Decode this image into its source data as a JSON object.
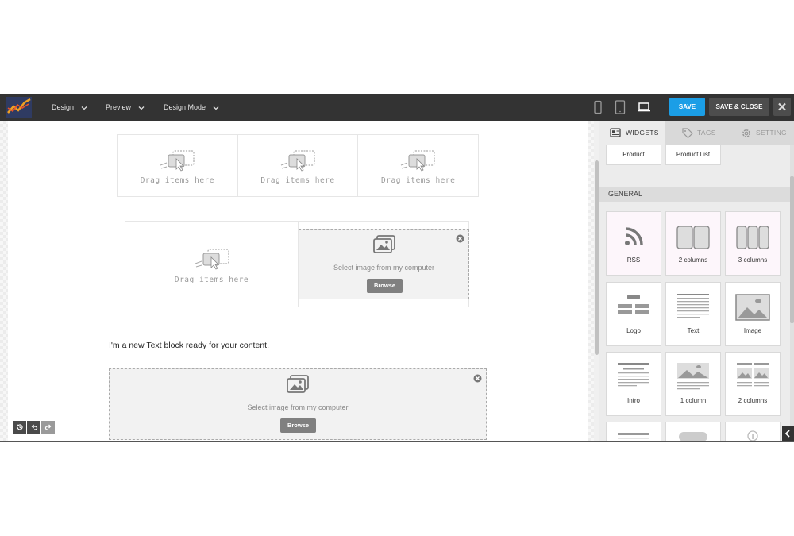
{
  "topbar": {
    "menus": [
      {
        "label": "Design"
      },
      {
        "label": "Preview"
      },
      {
        "label": "Design Mode"
      }
    ],
    "devices": [
      "mobile-icon",
      "tablet-icon",
      "laptop-icon"
    ],
    "save_label": "SAVE",
    "save_close_label": "SAVE & CLOSE",
    "colors": {
      "bar": "#333333",
      "save": "#1b9ee6",
      "save_close": "#4d4d4d"
    }
  },
  "canvas": {
    "drag_text": "Drag items here",
    "image_block": {
      "select_text": "Select image from my computer",
      "browse_label": "Browse"
    },
    "text_block": "I'm a new Text block ready for your content.",
    "undo_icons": [
      "history-icon",
      "undo-icon",
      "redo-icon"
    ]
  },
  "panel": {
    "tabs": [
      {
        "label": "WIDGETS",
        "icon": "widgets-icon",
        "active": true
      },
      {
        "label": "TAGS",
        "icon": "tag-icon",
        "active": false
      },
      {
        "label": "SETTING",
        "icon": "gear-icon",
        "active": false
      }
    ],
    "top_tiles": [
      {
        "label": "Product"
      },
      {
        "label": "Product List"
      }
    ],
    "general_header": "GENERAL",
    "widgets": [
      {
        "label": "RSS",
        "icon": "rss-icon"
      },
      {
        "label": "2 columns",
        "icon": "two-columns-icon"
      },
      {
        "label": "3 columns",
        "icon": "three-columns-icon"
      },
      {
        "label": "Logo",
        "icon": "logo-icon"
      },
      {
        "label": "Text",
        "icon": "text-icon"
      },
      {
        "label": "Image",
        "icon": "image-icon"
      },
      {
        "label": "Intro",
        "icon": "intro-icon"
      },
      {
        "label": "1 column",
        "icon": "one-column-icon"
      },
      {
        "label": "2 columns",
        "icon": "two-columns-image-icon"
      }
    ]
  }
}
